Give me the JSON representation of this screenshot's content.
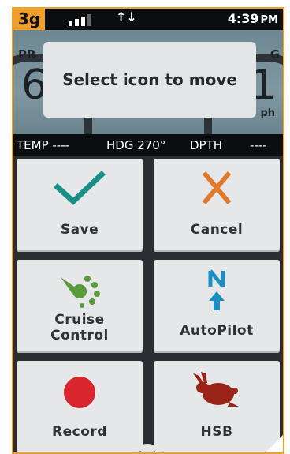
{
  "status_bar": {
    "network": "3g",
    "time": "4:39",
    "ampm": "PM"
  },
  "gauges": {
    "left_label": "PR",
    "left_value": "6",
    "right_label": "G",
    "right_value": "1",
    "right_unit": "ph"
  },
  "toast": {
    "message": "Select icon to move"
  },
  "readout": {
    "temp": "TEMP ----",
    "hdg": "HDG 270°",
    "dpth": "DPTH",
    "dpth_value": "----"
  },
  "tiles": [
    {
      "label": "Save",
      "icon": "checkmark-icon",
      "color": "#1a8f86"
    },
    {
      "label": "Cancel",
      "icon": "close-icon",
      "color": "#e07a2a"
    },
    {
      "label": "Cruise\nControl",
      "icon": "cruise-control-icon",
      "color": "#5a9a3a"
    },
    {
      "label": "AutoPilot",
      "icon": "autopilot-icon",
      "color": "#1a8fc2"
    },
    {
      "label": "Record",
      "icon": "record-icon",
      "color": "#d9262c"
    },
    {
      "label": "HSB",
      "icon": "rabbit-icon",
      "color": "#9a2418"
    }
  ],
  "colors": {
    "accent": "#f0a02a",
    "background": "#2a2d31"
  }
}
